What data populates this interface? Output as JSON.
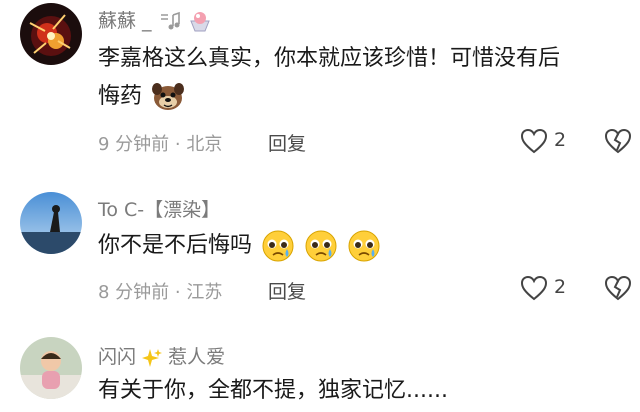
{
  "comments": [
    {
      "username": "蘇蘇 _ ",
      "text_line1": "李嘉格这么真实，你本就应该珍惜！可惜没有后",
      "text_line2": "悔药",
      "time": "9 分钟前",
      "location": "北京",
      "separator": "·",
      "reply_label": "回复",
      "likes": "2",
      "emoji": "dog-face-icon"
    },
    {
      "username": "To C-【漂染】",
      "text_line1": "你不是不后悔吗",
      "time": "8 分钟前",
      "location": "江苏",
      "separator": "·",
      "reply_label": "回复",
      "likes": "2",
      "emoji": "pleading-face-icon"
    },
    {
      "username": "闪闪",
      "username_suffix": "惹人爱",
      "text_line1": "有关于你，全都不提，独家记忆......"
    }
  ],
  "colors": {
    "meta": "#9a9a9a",
    "username": "#7b7b7b",
    "text": "#1a1a1a"
  }
}
